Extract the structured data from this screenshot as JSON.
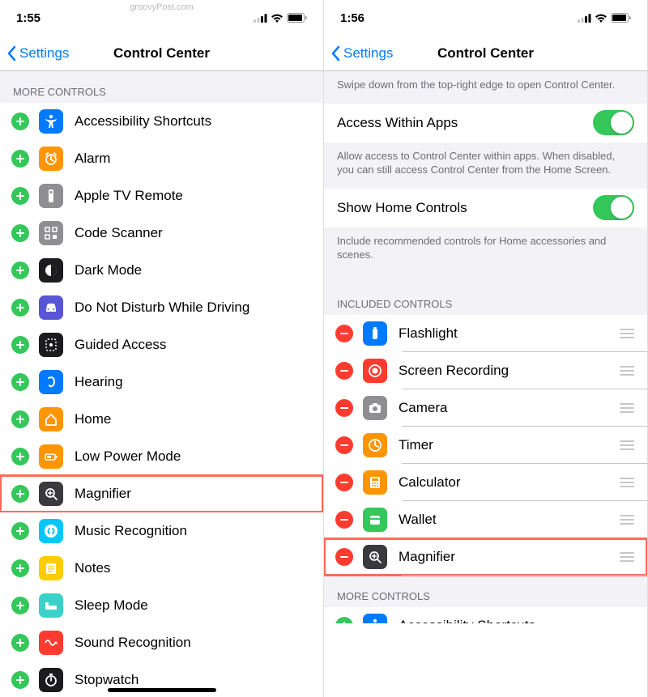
{
  "left": {
    "time": "1:55",
    "watermark": "groovyPost.com",
    "back": "Settings",
    "title": "Control Center",
    "section_more": "MORE CONTROLS",
    "items": [
      {
        "label": "Accessibility Shortcuts",
        "name": "accessibility-shortcuts",
        "bg": "#007aff",
        "icon": "accessibility"
      },
      {
        "label": "Alarm",
        "name": "alarm",
        "bg": "#ff9500",
        "icon": "alarm"
      },
      {
        "label": "Apple TV Remote",
        "name": "apple-tv-remote",
        "bg": "#8e8e93",
        "icon": "remote"
      },
      {
        "label": "Code Scanner",
        "name": "code-scanner",
        "bg": "#8e8e93",
        "icon": "qr"
      },
      {
        "label": "Dark Mode",
        "name": "dark-mode",
        "bg": "#1c1c1e",
        "icon": "darkmode"
      },
      {
        "label": "Do Not Disturb While Driving",
        "name": "dnd-driving",
        "bg": "#5856d6",
        "icon": "car"
      },
      {
        "label": "Guided Access",
        "name": "guided-access",
        "bg": "#1c1c1e",
        "icon": "guided"
      },
      {
        "label": "Hearing",
        "name": "hearing",
        "bg": "#007aff",
        "icon": "ear"
      },
      {
        "label": "Home",
        "name": "home",
        "bg": "#ff9500",
        "icon": "home"
      },
      {
        "label": "Low Power Mode",
        "name": "low-power-mode",
        "bg": "#ff9500",
        "icon": "battery"
      },
      {
        "label": "Magnifier",
        "name": "magnifier",
        "bg": "#3a3a3c",
        "icon": "mag",
        "hl": true
      },
      {
        "label": "Music Recognition",
        "name": "music-recognition",
        "bg": "#00c7fc",
        "icon": "shazam"
      },
      {
        "label": "Notes",
        "name": "notes",
        "bg": "#ffcc00",
        "icon": "notes"
      },
      {
        "label": "Sleep Mode",
        "name": "sleep-mode",
        "bg": "#38d2c8",
        "icon": "bed"
      },
      {
        "label": "Sound Recognition",
        "name": "sound-recognition",
        "bg": "#ff3b30",
        "icon": "sound"
      },
      {
        "label": "Stopwatch",
        "name": "stopwatch",
        "bg": "#1c1c1e",
        "icon": "stopwatch"
      }
    ]
  },
  "right": {
    "time": "1:56",
    "back": "Settings",
    "title": "Control Center",
    "desc_top": "Swipe down from the top-right edge to open Control Center.",
    "access_label": "Access Within Apps",
    "access_desc": "Allow access to Control Center within apps. When disabled, you can still access Control Center from the Home Screen.",
    "home_label": "Show Home Controls",
    "home_desc": "Include recommended controls for Home accessories and scenes.",
    "section_included": "INCLUDED CONTROLS",
    "included": [
      {
        "label": "Flashlight",
        "name": "flashlight",
        "bg": "#007aff",
        "icon": "flash"
      },
      {
        "label": "Screen Recording",
        "name": "screen-recording",
        "bg": "#ff3b30",
        "icon": "record"
      },
      {
        "label": "Camera",
        "name": "camera",
        "bg": "#8e8e93",
        "icon": "camera"
      },
      {
        "label": "Timer",
        "name": "timer",
        "bg": "#ff9500",
        "icon": "timer"
      },
      {
        "label": "Calculator",
        "name": "calculator",
        "bg": "#ff9500",
        "icon": "calc"
      },
      {
        "label": "Wallet",
        "name": "wallet",
        "bg": "#34c759",
        "icon": "wallet"
      },
      {
        "label": "Magnifier",
        "name": "magnifier",
        "bg": "#3a3a3c",
        "icon": "mag",
        "hl": true
      }
    ],
    "section_more": "MORE CONTROLS",
    "more": [
      {
        "label": "Accessibility Shortcuts",
        "name": "accessibility-shortcuts",
        "bg": "#007aff",
        "icon": "accessibility"
      }
    ]
  }
}
